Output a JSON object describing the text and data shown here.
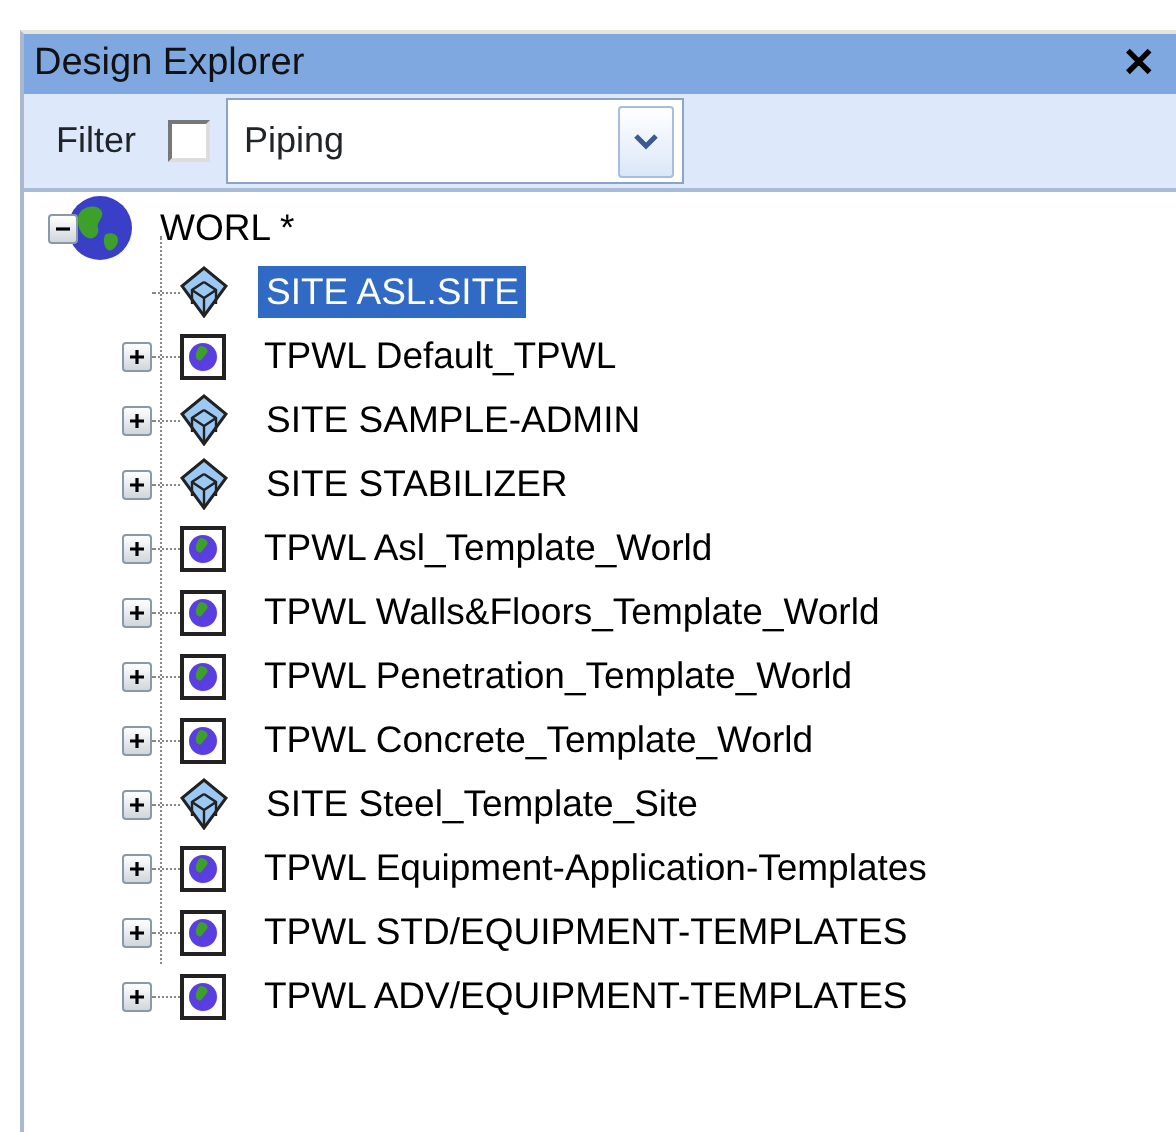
{
  "window": {
    "title": "Design Explorer",
    "close": "✕"
  },
  "filter": {
    "label": "Filter",
    "checked": false,
    "value": "Piping"
  },
  "tree": [
    {
      "label": "WORL *",
      "kind": "world",
      "expanded": true,
      "selected": false,
      "children": [
        {
          "label": "SITE ASL.SITE",
          "kind": "site",
          "selected": true
        },
        {
          "label": "TPWL Default_TPWL",
          "kind": "tpwl",
          "expanded": false,
          "selected": false
        },
        {
          "label": "SITE SAMPLE-ADMIN",
          "kind": "site",
          "expanded": false,
          "selected": false
        },
        {
          "label": "SITE STABILIZER",
          "kind": "site",
          "expanded": false,
          "selected": false
        },
        {
          "label": "TPWL Asl_Template_World",
          "kind": "tpwl",
          "expanded": false,
          "selected": false
        },
        {
          "label": "TPWL Walls&Floors_Template_World",
          "kind": "tpwl",
          "expanded": false,
          "selected": false
        },
        {
          "label": "TPWL Penetration_Template_World",
          "kind": "tpwl",
          "expanded": false,
          "selected": false
        },
        {
          "label": "TPWL Concrete_Template_World",
          "kind": "tpwl",
          "expanded": false,
          "selected": false
        },
        {
          "label": "SITE Steel_Template_Site",
          "kind": "site",
          "expanded": false,
          "selected": false
        },
        {
          "label": "TPWL Equipment-Application-Templates",
          "kind": "tpwl",
          "expanded": false,
          "selected": false
        },
        {
          "label": "TPWL STD/EQUIPMENT-TEMPLATES",
          "kind": "tpwl",
          "expanded": false,
          "selected": false
        },
        {
          "label": "TPWL ADV/EQUIPMENT-TEMPLATES",
          "kind": "tpwl",
          "expanded": false,
          "selected": false
        }
      ]
    }
  ]
}
